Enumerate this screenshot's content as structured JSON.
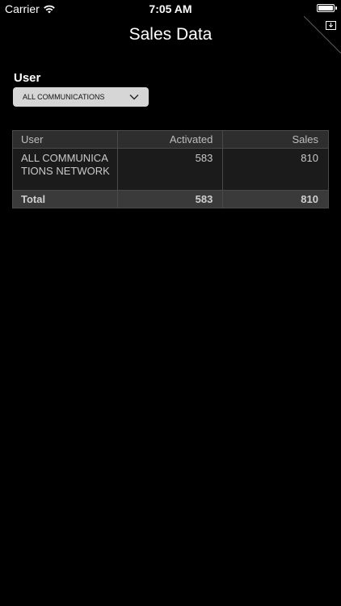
{
  "status_bar": {
    "carrier": "Carrier",
    "time": "7:05 AM",
    "wifi_icon": "wifi-icon",
    "battery_icon": "battery-icon"
  },
  "corner_tab": {
    "icon": "download-icon"
  },
  "header": {
    "title": "Sales Data"
  },
  "filter": {
    "label": "User",
    "selected": "ALL COMMUNICATIONS",
    "icon": "chevron-down-icon"
  },
  "table": {
    "columns": [
      "User",
      "Activated",
      "Sales"
    ],
    "rows": [
      {
        "user": " ALL COMMUNICATIONS NETWORK",
        "activated": "583",
        "sales": "810"
      }
    ],
    "total": {
      "label": "Total",
      "activated": "583",
      "sales": "810"
    }
  },
  "colors": {
    "background": "#000000",
    "header_cell": "#2e2e2e",
    "body_cell": "#1b1b1b",
    "total_cell": "#3a3a3a",
    "dropdown": "#d6d6d6"
  }
}
